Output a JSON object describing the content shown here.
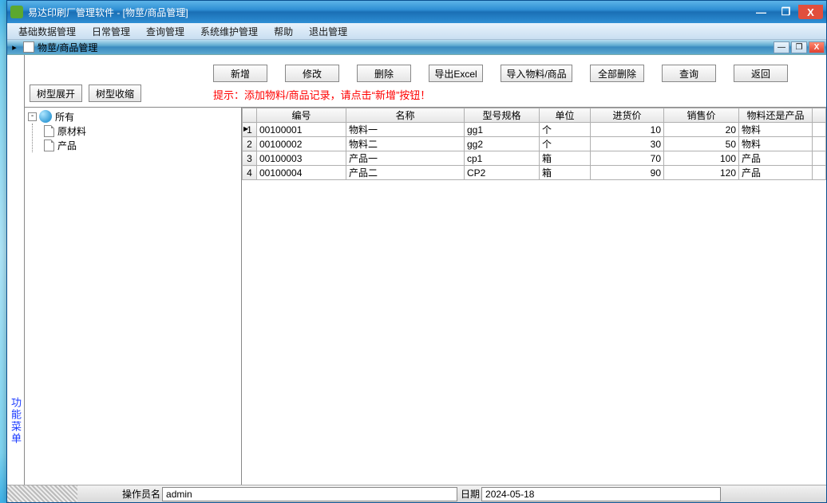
{
  "window": {
    "title": "易达印刷厂管理软件  - [物莖/商品管理]"
  },
  "menubar": {
    "items": [
      "基础数据管理",
      "日常管理",
      "查询管理",
      "系统维护管理",
      "帮助",
      "退出管理"
    ]
  },
  "subwindow": {
    "title": "物莖/商品管理"
  },
  "toolbar": {
    "expand": "树型展开",
    "collapse": "树型收缩",
    "new": "新增",
    "edit": "修改",
    "delete": "删除",
    "export": "导出Excel",
    "import": "导入物料/商品",
    "delete_all": "全部删除",
    "query": "查询",
    "back": "返回",
    "hint": "提示：添加物料/商品记录，请点击“新增”按钮！"
  },
  "tree": {
    "root": "所有",
    "children": [
      "原材料",
      "产品"
    ]
  },
  "grid": {
    "columns": [
      "编号",
      "名称",
      "型号规格",
      "单位",
      "进货价",
      "销售价",
      "物料还是产品"
    ],
    "rows": [
      {
        "n": "1",
        "code": "00100001",
        "name": "物料一",
        "spec": "gg1",
        "unit": "个",
        "buy": "10",
        "sell": "20",
        "kind": "物料"
      },
      {
        "n": "2",
        "code": "00100002",
        "name": "物料二",
        "spec": "gg2",
        "unit": "个",
        "buy": "30",
        "sell": "50",
        "kind": "物料"
      },
      {
        "n": "3",
        "code": "00100003",
        "name": "产品一",
        "spec": "cp1",
        "unit": "箱",
        "buy": "70",
        "sell": "100",
        "kind": "产品"
      },
      {
        "n": "4",
        "code": "00100004",
        "name": "产品二",
        "spec": "CP2",
        "unit": "箱",
        "buy": "90",
        "sell": "120",
        "kind": "产品"
      }
    ]
  },
  "leftstrip": {
    "text": "功能菜单"
  },
  "statusbar": {
    "operator_label": "操作员名",
    "operator_value": "admin",
    "date_label": "日期",
    "date_value": "2024-05-18"
  }
}
